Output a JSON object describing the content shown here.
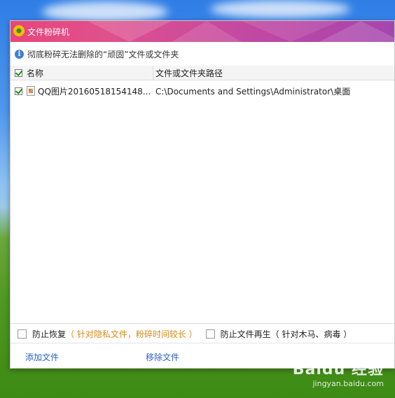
{
  "window": {
    "title": "文件粉碎机"
  },
  "info": {
    "text": "彻底粉碎无法删除的“顽固”文件或文件夹"
  },
  "table": {
    "columns": [
      "名称",
      "文件或文件夹路径"
    ],
    "rows": [
      {
        "name": "QQ图片20160518154148...",
        "path": "C:\\Documents and Settings\\Administrator\\桌面",
        "checked": true
      }
    ]
  },
  "options": {
    "prevent_recovery": {
      "label": "防止恢复",
      "hint": "（ 针对隐私文件，粉碎时间较长 ）",
      "checked": false
    },
    "prevent_regenerate": {
      "label": "防止文件再生",
      "hint": "（ 针对木马、病毒 ）",
      "checked": false
    }
  },
  "actions": {
    "add_file": "添加文件",
    "remove_file": "移除文件"
  },
  "watermark": {
    "brand": "Baidu 经验",
    "url": "jingyan.baidu.com"
  },
  "colors": {
    "title_gradient_start": "#e8457a",
    "title_gradient_end": "#a446b0",
    "link": "#2a62c2",
    "hint": "#d88a1a",
    "check": "#1d8a1d"
  }
}
